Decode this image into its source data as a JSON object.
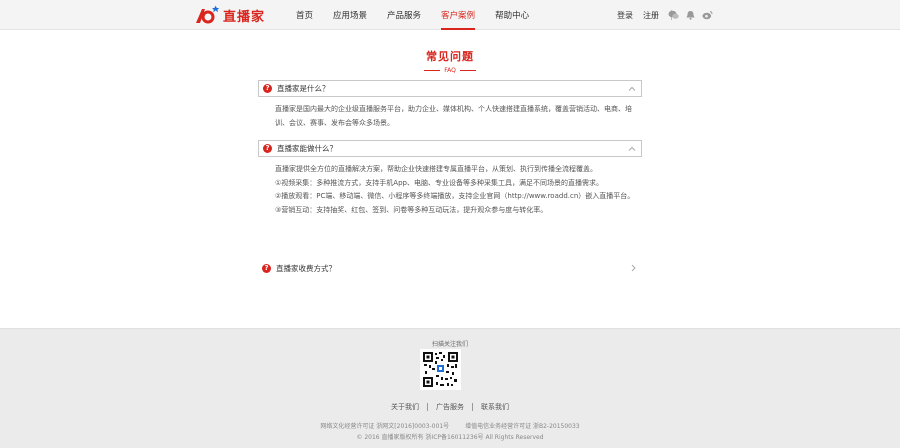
{
  "header": {
    "logo_text": "直播家",
    "colors": {
      "brand": "#d9251d",
      "header_bg": "#f4f4f4",
      "footer_bg": "#ebebeb"
    },
    "nav": [
      {
        "label": "首页",
        "active": false
      },
      {
        "label": "应用场景",
        "active": false
      },
      {
        "label": "产品服务",
        "active": false
      },
      {
        "label": "客户案例",
        "active": true
      },
      {
        "label": "帮助中心",
        "active": false
      }
    ],
    "login": "登录",
    "register": "注册",
    "icons": [
      "wechat-icon",
      "bell-icon",
      "weibo-icon"
    ]
  },
  "section": {
    "title": "常见问题",
    "subtitle": "FAQ"
  },
  "faq": [
    {
      "question": "直播家是什么？",
      "state": "open",
      "answer": [
        "直播家是国内最大的企业级直播服务平台，助力企业、媒体机构、个人快速搭建直播系统，覆盖营销活动、电商、培训、会议、赛事、发布会等众多场景。"
      ]
    },
    {
      "question": "直播家能做什么？",
      "state": "open",
      "answer": [
        "直播家提供全方位的直播解决方案，帮助企业快速搭建专属直播平台，从策划、执行到传播全流程覆盖。",
        "①视频采集：多种推流方式，支持手机App、电脑、专业设备等多种采集工具，满足不同场景的直播需求。",
        "②播放观看：PC端、移动端、微信、小程序等多终端播放，支持企业官网（http://www.roadd.cn）嵌入直播平台。",
        "③营销互动：支持抽奖、红包、签到、问卷等多种互动玩法，提升观众参与度与转化率。"
      ]
    },
    {
      "question": "直播家收费方式？",
      "state": "closed",
      "answer": []
    }
  ],
  "footer": {
    "qr_label": "扫描关注我们",
    "links": [
      "关于我们",
      "广告服务",
      "联系我们"
    ],
    "icp_left": "网络文化经营许可证 浙网文[2016]0003-001号",
    "icp_right": "增值电信业务经营许可证 浙B2-20150033",
    "copyright": "© 2016 直播家版权所有 浙ICP备16011236号 All Rights Reserved"
  }
}
